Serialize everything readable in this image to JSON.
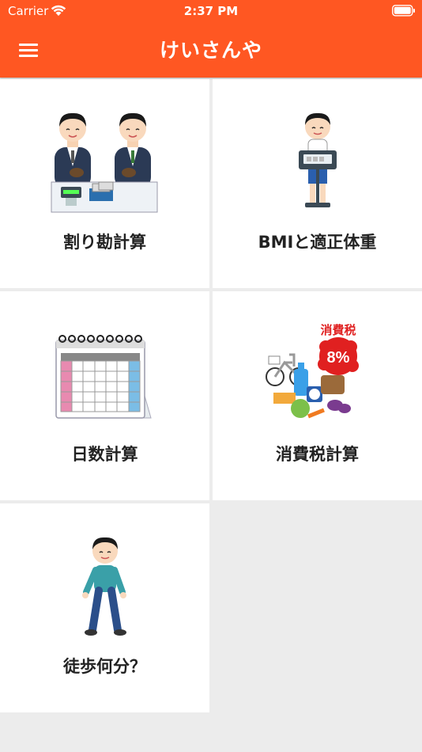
{
  "status": {
    "carrier": "Carrier",
    "time": "2:37 PM"
  },
  "nav": {
    "title": "けいさんや",
    "menu_icon": "hamburger-menu-icon"
  },
  "menu": [
    {
      "label": "割り勘計算",
      "icon": "bill-split-illustration"
    },
    {
      "label": "BMIと適正体重",
      "icon": "weighing-scale-illustration"
    },
    {
      "label": "日数計算",
      "icon": "calendar-illustration"
    },
    {
      "label": "消費税計算",
      "icon": "consumption-tax-illustration",
      "badge_title": "消費税",
      "badge_rate": "8%"
    },
    {
      "label": "徒歩何分？",
      "icon": "walking-person-illustration"
    }
  ],
  "colors": {
    "accent": "#ff5722",
    "background": "#ececec",
    "tile": "#ffffff"
  }
}
